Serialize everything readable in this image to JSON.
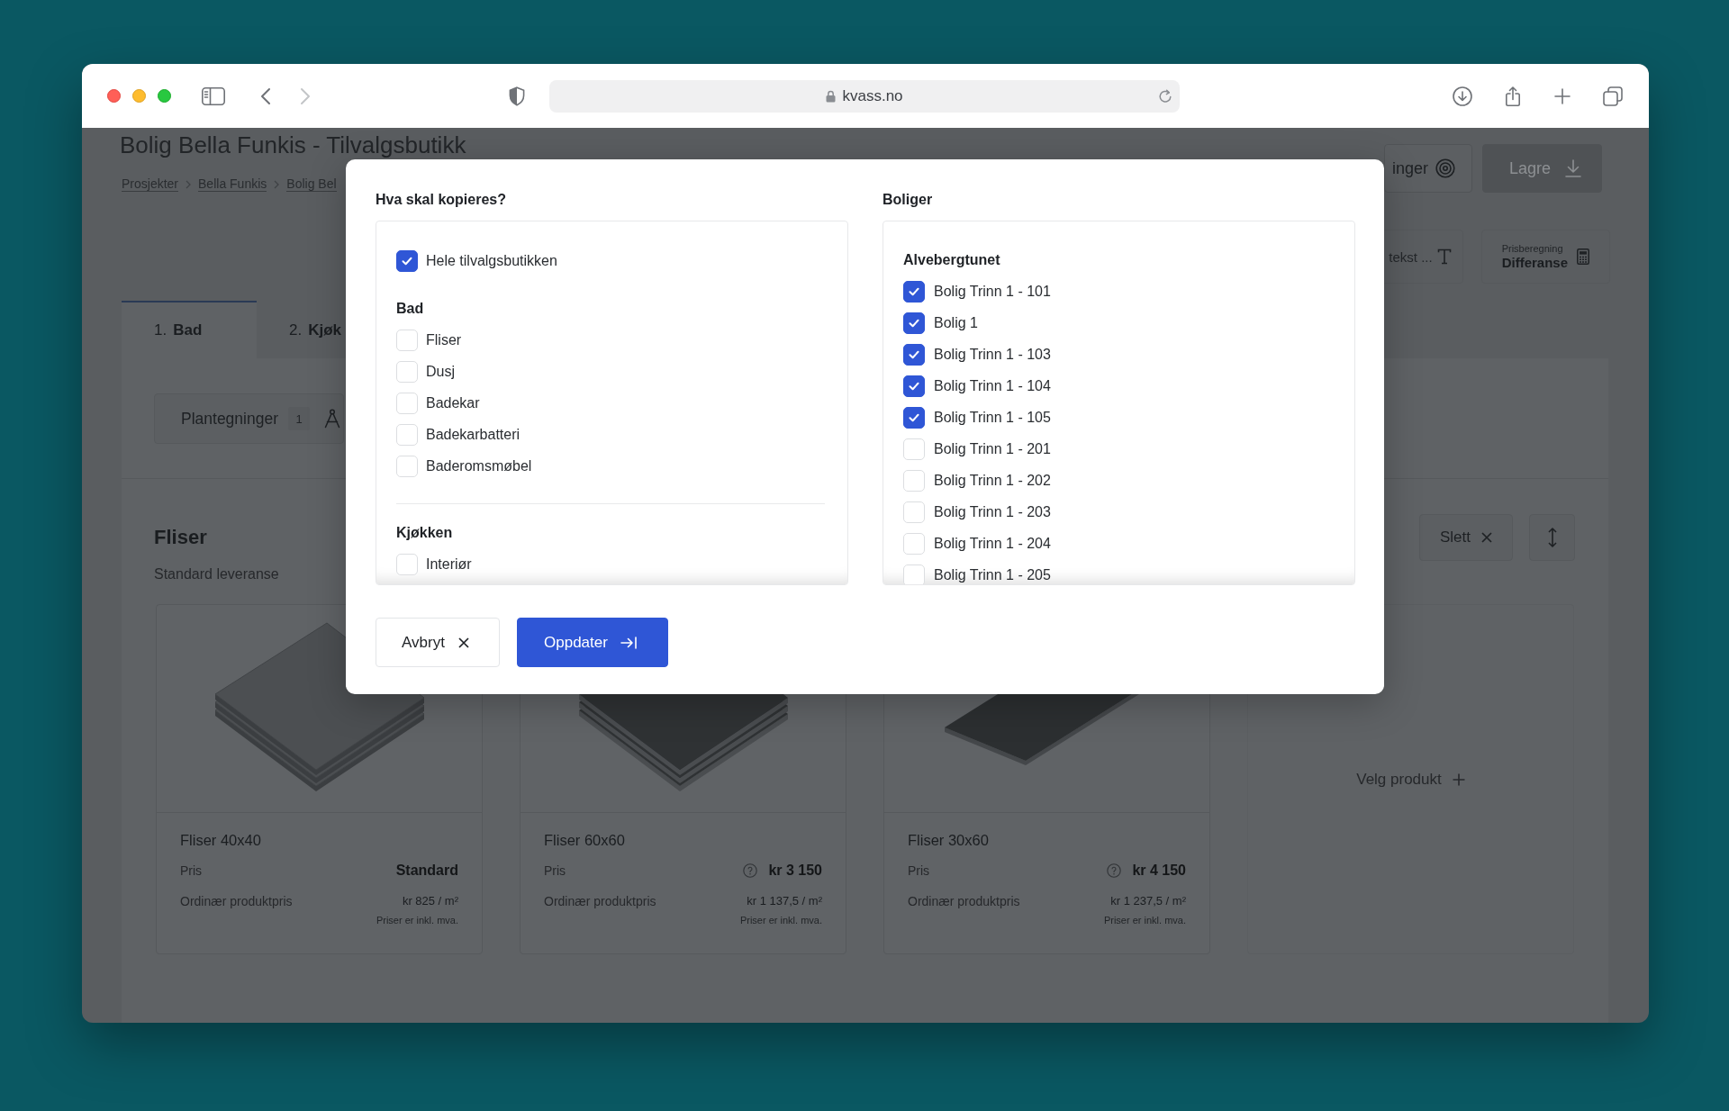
{
  "browser": {
    "url": "kvass.no",
    "nav": [
      {
        "kind": "back",
        "disabled": false
      },
      {
        "kind": "forward",
        "disabled": true
      }
    ]
  },
  "page": {
    "title": "Bolig Bella Funkis - Tilvalgsbutikk",
    "breadcrumbs": [
      "Prosjekter",
      "Bella Funkis",
      "Bolig Bel"
    ],
    "header_buttons": [
      {
        "kind": "target",
        "label": "inger",
        "disabled": false
      },
      {
        "kind": "save",
        "label": "Lagre",
        "disabled": true
      }
    ],
    "text_select": {
      "label": "tekst ..."
    },
    "price_calc": {
      "label": "Prisberegning",
      "value": "Differanse"
    },
    "tabs": [
      {
        "number": "1.",
        "label": "Bad",
        "selected": true
      },
      {
        "number": "2.",
        "label": "Kjøk",
        "selected": false
      }
    ],
    "floorplans": {
      "label": "Plantegninger",
      "count": "1"
    },
    "section": {
      "title": "Fliser",
      "subtitle": "Standard leveranse",
      "delete_label": "Slett"
    },
    "products": [
      {
        "name": "Fliser 40x40",
        "price_label": "Pris",
        "price": "Standard",
        "help": false,
        "ordinary_label": "Ordinær produktpris",
        "ordinary_price": "kr 825 / m²",
        "vat_note": "Priser er inkl. mva."
      },
      {
        "name": "Fliser 60x60",
        "price_label": "Pris",
        "price": "kr 3 150",
        "help": true,
        "ordinary_label": "Ordinær produktpris",
        "ordinary_price": "kr 1 137,5 / m²",
        "vat_note": "Priser er inkl. mva."
      },
      {
        "name": "Fliser 30x60",
        "price_label": "Pris",
        "price": "kr 4 150",
        "help": true,
        "ordinary_label": "Ordinær produktpris",
        "ordinary_price": "kr 1 237,5 / m²",
        "vat_note": "Priser er inkl. mva."
      }
    ],
    "add_product": "Velg produkt"
  },
  "dialog": {
    "left": {
      "title": "Hva skal kopieres?",
      "select_all": {
        "label": "Hele tilvalgsbutikken",
        "checked": true
      },
      "groups": [
        {
          "title": "Bad",
          "items": [
            {
              "label": "Fliser",
              "checked": false
            },
            {
              "label": "Dusj",
              "checked": false
            },
            {
              "label": "Badekar",
              "checked": false
            },
            {
              "label": "Badekarbatteri",
              "checked": false
            },
            {
              "label": "Baderomsmøbel",
              "checked": false
            }
          ]
        },
        {
          "title": "Kjøkken",
          "items": [
            {
              "label": "Interiør",
              "checked": false
            }
          ]
        }
      ]
    },
    "right": {
      "title": "Boliger",
      "groups": [
        {
          "title": "Alvebergtunet",
          "items": [
            {
              "label": "Bolig Trinn 1 - 101",
              "checked": true
            },
            {
              "label": "Bolig 1",
              "checked": true
            },
            {
              "label": "Bolig Trinn 1 - 103",
              "checked": true
            },
            {
              "label": "Bolig Trinn 1 - 104",
              "checked": true
            },
            {
              "label": "Bolig Trinn 1 - 105",
              "checked": true
            },
            {
              "label": "Bolig Trinn 1 - 201",
              "checked": false
            },
            {
              "label": "Bolig Trinn 1 - 202",
              "checked": false
            },
            {
              "label": "Bolig Trinn 1 - 203",
              "checked": false
            },
            {
              "label": "Bolig Trinn 1 - 204",
              "checked": false
            },
            {
              "label": "Bolig Trinn 1 - 205",
              "checked": false
            }
          ]
        }
      ]
    },
    "buttons": [
      {
        "kind": "cancel",
        "label": "Avbryt"
      },
      {
        "kind": "confirm",
        "label": "Oppdater"
      }
    ]
  }
}
